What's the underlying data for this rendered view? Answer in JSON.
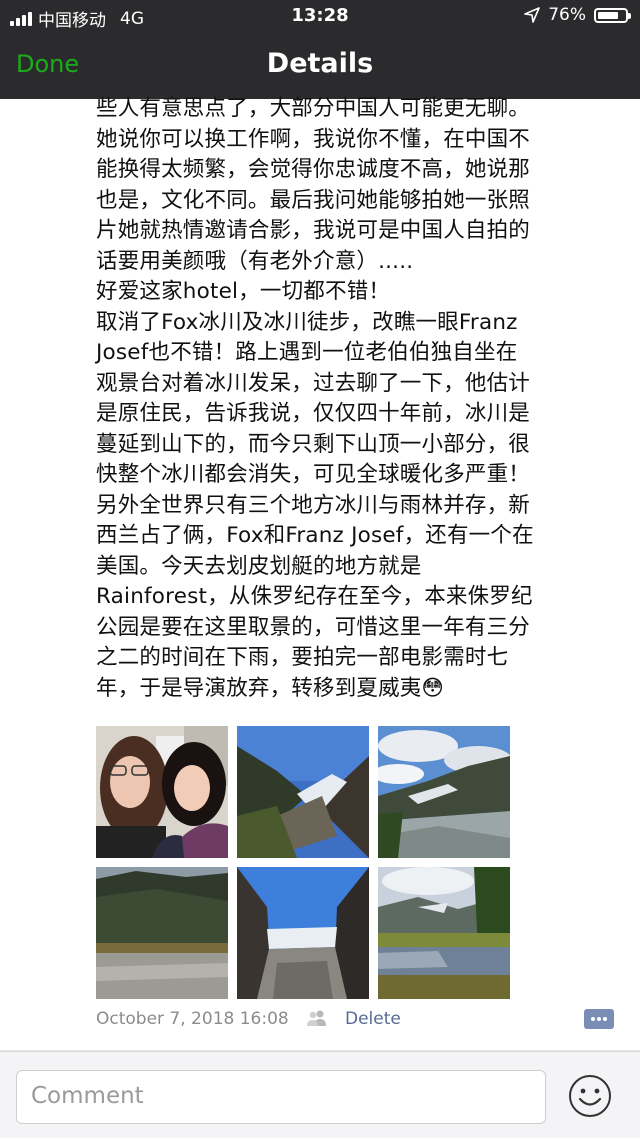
{
  "status_bar": {
    "carrier": "中国移动",
    "network": "4G",
    "time": "13:28",
    "battery_percent": "76%",
    "battery_level": 0.76,
    "icons": [
      "signal-icon",
      "location-arrow-icon",
      "battery-icon"
    ]
  },
  "nav": {
    "done_label": "Done",
    "title": "Details"
  },
  "post": {
    "text": "些人有意思点了，大部分中国人可能更无聊。\n她说你可以换工作啊，我说你不懂，在中国不\n能换得太频繁，会觉得你忠诚度不高，她说那\n也是，文化不同。最后我问她能够拍她一张照\n片她就热情邀请合影，我说可是中国人自拍的\n话要用美颜哦（有老外介意）.....\n好爱这家hotel，一切都不错！\n取消了Fox冰川及冰川徒步，改瞧一眼Franz\nJosef也不错！路上遇到一位老伯伯独自坐在\n观景台对着冰川发呆，过去聊了一下，他估计\n是原住民，告诉我说，仅仅四十年前，冰川是\n蔓延到山下的，而今只剩下山顶一小部分，很\n快整个冰川都会消失，可见全球暖化多严重！\n另外全世界只有三个地方冰川与雨林并存，新\n西兰占了俩，Fox和Franz Josef，还有一个在\n美国。今天去划皮划艇的地方就是\nRainforest，从侏罗纪存在至今，本来侏罗纪\n公园是要在这里取景的，可惜这里一年有三分\n之二的时间在下雨，要拍完一部电影需时七\n年，于是导演放弃，转移到夏威夷😳",
    "photos": [
      {
        "subject": "two-women-selfie"
      },
      {
        "subject": "glacier-valley"
      },
      {
        "subject": "glacier-river-clouds"
      },
      {
        "subject": "mountains-gravel-riverbed"
      },
      {
        "subject": "glacier-rock-walls"
      },
      {
        "subject": "rainforest-lake-reflection"
      }
    ],
    "timestamp": "October 7, 2018 16:08",
    "delete_label": "Delete"
  },
  "comment_bar": {
    "placeholder": "Comment"
  },
  "colors": {
    "nav_background": "#2b2b2d",
    "done_green": "#1aad19",
    "link_blue": "#576b95",
    "meta_gray": "#8c8c8c"
  }
}
